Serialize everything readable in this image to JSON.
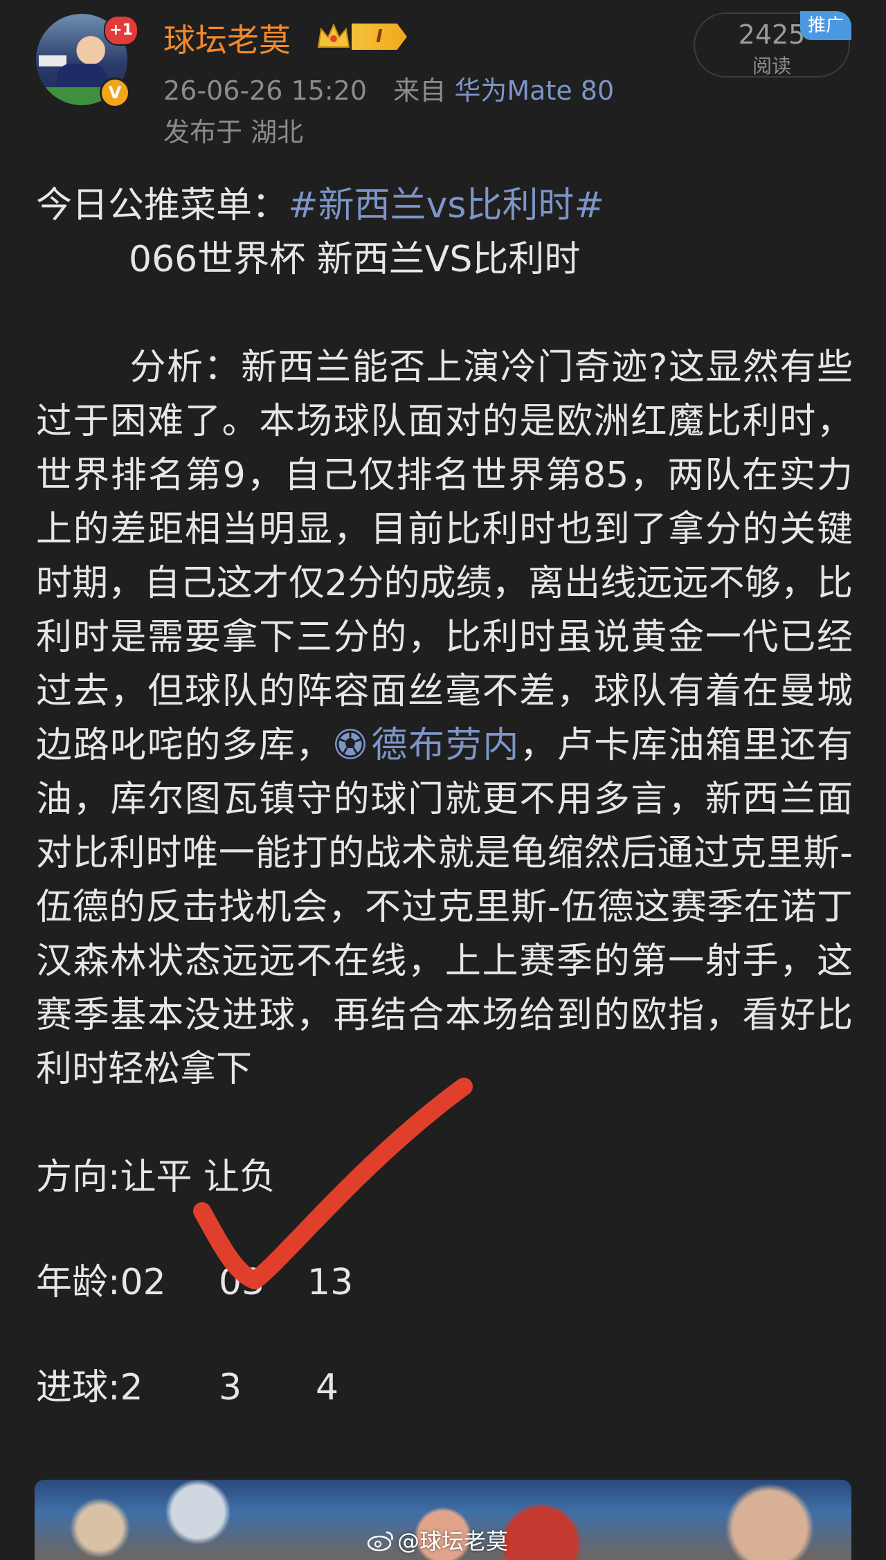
{
  "header": {
    "username": "球坛老莫",
    "level_badge": "I",
    "notification_badge": "+1",
    "verified_badge": "V",
    "timestamp": "26-06-26 15:20",
    "source_prefix": "来自",
    "device": "华为Mate 80",
    "location": "发布于 湖北",
    "read_count": "2425",
    "read_label": "阅读",
    "promo_label": "推广"
  },
  "post": {
    "intro_prefix": "今日公推菜单：",
    "hashtag": "#新西兰vs比利时#",
    "match_line": "066世界杯 新西兰VS比利时",
    "analysis_part1": "分析：新西兰能否上演冷门奇迹?这显然有些过于困难了。本场球队面对的是欧洲红魔比利时，世界排名第9，自己仅排名世界第85，两队在实力上的差距相当明显，目前比利时也到了拿分的关键时期，自己这才仅2分的成绩，离出线远远不够，比利时是需要拿下三分的，比利时虽说黄金一代已经过去，但球队的阵容面丝毫不差，球队有着在曼城边路叱咤的多库，",
    "mention_link": "德布劳内",
    "analysis_part2": "，卢卡库油箱里还有油，库尔图瓦镇守的球门就更不用多言，新西兰面对比利时唯一能打的战术就是龟缩然后通过克里斯-伍德的反击找机会，不过克里斯-伍德这赛季在诺丁汉森林状态远远不在线，上上赛季的第一射手，这赛季基本没进球，再结合本场给到的欧指，看好比利时轻松拿下",
    "direction": "方向:让平 让负",
    "age_label": "年龄:02",
    "age_v2": "03",
    "age_v3": "13",
    "goals_label": "进球:2",
    "goals_v2": "3",
    "goals_v3": "4"
  },
  "watermark": "@球坛老莫",
  "colors": {
    "background": "#1f1f1f",
    "username": "#f08a2c",
    "link": "#7d95c8",
    "check_mark": "#e0402b"
  },
  "icons": [
    "crown-icon",
    "soccer-ball-icon",
    "weibo-icon",
    "checkmark-icon"
  ]
}
